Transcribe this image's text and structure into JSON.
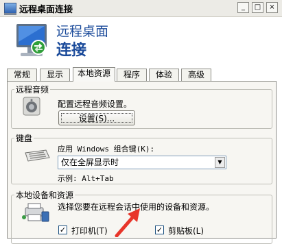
{
  "window": {
    "title": "远程桌面连接",
    "minimize": "_",
    "maximize": "□",
    "close": "×"
  },
  "header": {
    "subtitle": "远程桌面",
    "title": "连接"
  },
  "tabs": [
    {
      "label": "常规"
    },
    {
      "label": "显示"
    },
    {
      "label": "本地资源",
      "active": true
    },
    {
      "label": "程序"
    },
    {
      "label": "体验"
    },
    {
      "label": "高级"
    }
  ],
  "audio": {
    "legend": "远程音频",
    "description": "配置远程音频设置。",
    "settings_button": "设置(S)..."
  },
  "keyboard": {
    "legend": "键盘",
    "label": "应用 Windows 组合键(K):",
    "selected": "仅在全屏显示时",
    "example": "示例: Alt+Tab"
  },
  "devices": {
    "legend": "本地设备和资源",
    "description": "选择您要在远程会话中使用的设备和资源。",
    "printer_label": "打印机(T)",
    "printer_checked": true,
    "clipboard_label": "剪贴板(L)",
    "clipboard_checked": true
  },
  "annotation": {
    "arrow_color": "#e8352a"
  }
}
